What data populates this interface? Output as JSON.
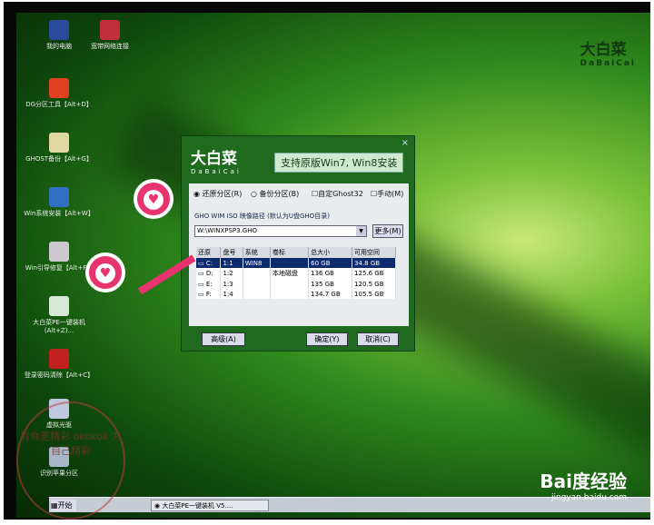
{
  "desktop": {
    "icons": [
      {
        "label": "我的电脑",
        "color": "#2a4a9a"
      },
      {
        "label": "宽带网络连接",
        "color": "#c0303a"
      },
      {
        "label": "DG分区工具【Alt+D】",
        "color": "#e04020"
      },
      {
        "label": "GHOST备份【Alt+G】",
        "color": "#e0d8a0"
      },
      {
        "label": "Win系统安装【Alt+W】",
        "color": "#3070c0"
      },
      {
        "label": "Win引导修复【Alt+F】",
        "color": "#d0c8d0"
      },
      {
        "label": "大白菜PE一键装机(Alt+Z)...",
        "color": "#d8e8d8"
      },
      {
        "label": "登录密码清除【Alt+C】",
        "color": "#c02020"
      },
      {
        "label": "虚拟光驱",
        "color": "#c0c8e0"
      },
      {
        "label": "识别苹果分区",
        "color": "#a8b8c8"
      }
    ],
    "logo": {
      "cn": "大白菜",
      "en": "DaBaiCai"
    }
  },
  "dialog": {
    "close": "×",
    "brand_cn": "大白菜",
    "brand_en": "DaBaiCai",
    "slogan": "支持原版Win7, Win8安装",
    "options": [
      "还原分区(R)",
      "备份分区(B)",
      "自定Ghost32",
      "手动(M)"
    ],
    "path_label": "GHO WIM ISO 映像路径 (默认为U盘GHO目录)",
    "path_value": "W:\\WINXPSP3.GHO",
    "more": "更多(M)",
    "columns": [
      "还原",
      "盘号",
      "系统",
      "卷标",
      "总大小",
      "可用空间"
    ],
    "rows": [
      [
        "C:",
        "1:1",
        "WIN8",
        "",
        "60 GB",
        "34.8 GB"
      ],
      [
        "D:",
        "1:2",
        "",
        "本地磁盘",
        "136 GB",
        "125.6 GB"
      ],
      [
        "E:",
        "1:3",
        "",
        "",
        "135 GB",
        "120.5 GB"
      ],
      [
        "F:",
        "1:4",
        "",
        "",
        "134.7 GB",
        "105.5 GB"
      ]
    ],
    "advanced": "高级(A)",
    "ok": "确定(Y)",
    "cancel": "取消(C)"
  },
  "taskbar": {
    "start": "开始",
    "task": "大白菜PE一键装机 V5...."
  },
  "watermarks": {
    "circle": "有你更精彩 okokok 为自己精彩",
    "baidu": "Bai度经验",
    "baidu_url": "jingyan.baidu.com"
  }
}
